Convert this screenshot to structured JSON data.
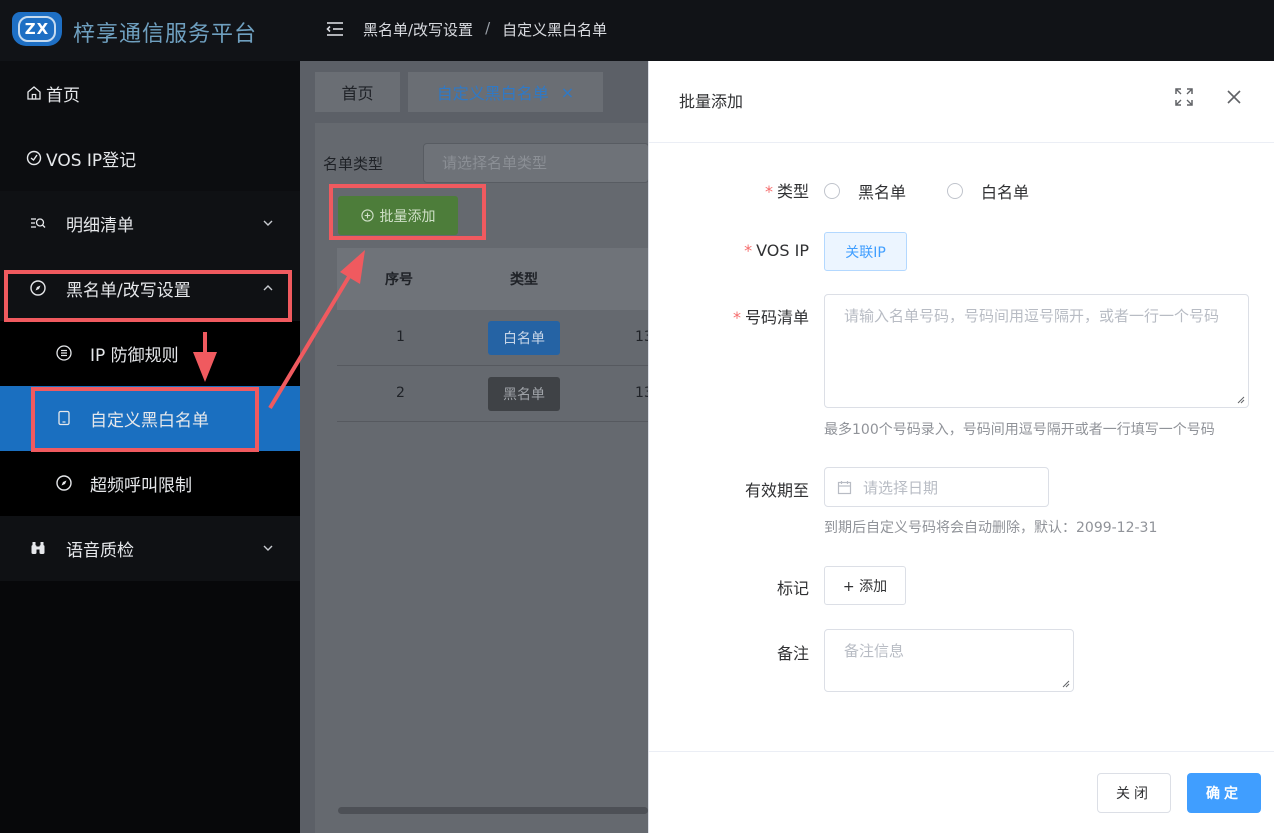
{
  "header": {
    "logo_text": "ZX",
    "app_title": "梓享通信服务平台",
    "breadcrumb": [
      "黑名单/改写设置",
      "/",
      "自定义黑白名单"
    ]
  },
  "sidebar": {
    "items": [
      {
        "label": "首页",
        "icon": "home-icon"
      },
      {
        "label": "VOS IP登记",
        "icon": "clock-icon"
      },
      {
        "label": "明细清单",
        "icon": "search-list-icon"
      },
      {
        "label": "黑名单/改写设置",
        "icon": "compass-icon",
        "expanded": true
      },
      {
        "label": "IP 防御规则",
        "icon": "list-icon"
      },
      {
        "label": "自定义黑白名单",
        "icon": "tablet-icon",
        "active": true
      },
      {
        "label": "超频呼叫限制",
        "icon": "compass-icon"
      },
      {
        "label": "语音质检",
        "icon": "binoculars-icon"
      }
    ]
  },
  "tabs": [
    {
      "label": "首页"
    },
    {
      "label": "自定义黑白名单",
      "close": "×"
    }
  ],
  "filter": {
    "label": "名单类型",
    "placeholder": "请选择名单类型"
  },
  "toolbar": {
    "batch_add_label": "批量添加"
  },
  "table": {
    "headers": [
      "序号",
      "类型"
    ],
    "rows": [
      {
        "index": "1",
        "type": "白名单",
        "partial": "13"
      },
      {
        "index": "2",
        "type": "黑名单",
        "partial": "13"
      }
    ]
  },
  "drawer": {
    "title": "批量添加",
    "form": {
      "type_label": "类型",
      "type_options": [
        "黑名单",
        "白名单"
      ],
      "vos_ip_label": "VOS IP",
      "vos_ip_button": "关联IP",
      "numbers_label": "号码清单",
      "numbers_placeholder": "请输入名单号码，号码间用逗号隔开，或者一行一个号码",
      "numbers_hint": "最多100个号码录入，号码间用逗号隔开或者一行填写一个号码",
      "expiry_label": "有效期至",
      "expiry_placeholder": "请选择日期",
      "expiry_hint": "到期后自定义号码将会自动删除，默认：2099-12-31",
      "tag_label": "标记",
      "tag_button": "+ 添加",
      "remark_label": "备注",
      "remark_placeholder": "备注信息"
    },
    "footer": {
      "close_label": "关闭",
      "confirm_label": "确定"
    }
  },
  "colors": {
    "primary": "#409eff",
    "annotation_red": "#f05a5f",
    "sidebar_active": "#1a6fc0"
  }
}
